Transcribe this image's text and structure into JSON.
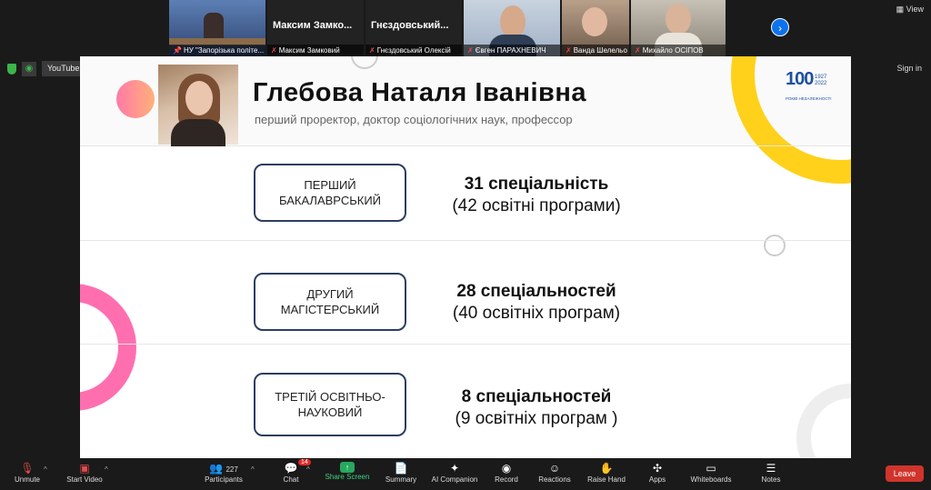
{
  "participants": {
    "next_label": "›",
    "tiles": [
      {
        "name": "НУ \"Запорізька політе...",
        "bigname": "",
        "muted": false
      },
      {
        "name": "Максим Замковий",
        "bigname": "Максим Замко...",
        "muted": true
      },
      {
        "name": "Гнєздовський Олексій",
        "bigname": "Гнєздовський...",
        "muted": true
      },
      {
        "name": "Євген ПАРАХНЕВИЧ",
        "bigname": "",
        "muted": true
      },
      {
        "name": "Ванда Шелельо",
        "bigname": "",
        "muted": true
      },
      {
        "name": "Михайло ОСІПОВ",
        "bigname": "",
        "muted": true
      }
    ]
  },
  "view_label": "View",
  "share_bar": {
    "source_label": "YouTube",
    "signin_label": "Sign in"
  },
  "slide": {
    "title": "Глебова Наталя Іванівна",
    "subtitle": "перший проректор, доктор соціологічних наук, профессор",
    "logo": {
      "number": "100",
      "years": "1927 2022",
      "caption": "РОКІВ НЕЗАЛЕЖНОСТІ"
    },
    "rows": [
      {
        "level": "ПЕРШИЙ БАКАЛАВРСЬКИЙ",
        "specialties": "31 спеціальність",
        "programs": "(42 освітні програми)"
      },
      {
        "level": "ДРУГИЙ МАГІСТЕРСЬКИЙ",
        "specialties": "28 спеціальностей",
        "programs": "(40 освітніх програм)"
      },
      {
        "level": "ТРЕТІЙ ОСВІТНЬО-НАУКОВИЙ",
        "specialties": "8 спеціальностей",
        "programs": "(9 освітніх програм )"
      }
    ]
  },
  "toolbar": {
    "unmute": "Unmute",
    "start_video": "Start Video",
    "participants": "Participants",
    "participants_count": "227",
    "chat": "Chat",
    "chat_badge": "14",
    "share_screen": "Share Screen",
    "summary": "Summary",
    "ai_companion": "AI Companion",
    "record": "Record",
    "reactions": "Reactions",
    "raise_hand": "Raise Hand",
    "apps": "Apps",
    "whiteboards": "Whiteboards",
    "notes": "Notes",
    "leave": "Leave"
  },
  "colors": {
    "accent_blue": "#0e72ed",
    "share_green": "#27a85f",
    "leave_red": "#d0342c",
    "slide_yellow": "#ffd11a",
    "slide_pink": "#ff6fb0",
    "box_border": "#2c3e60"
  }
}
